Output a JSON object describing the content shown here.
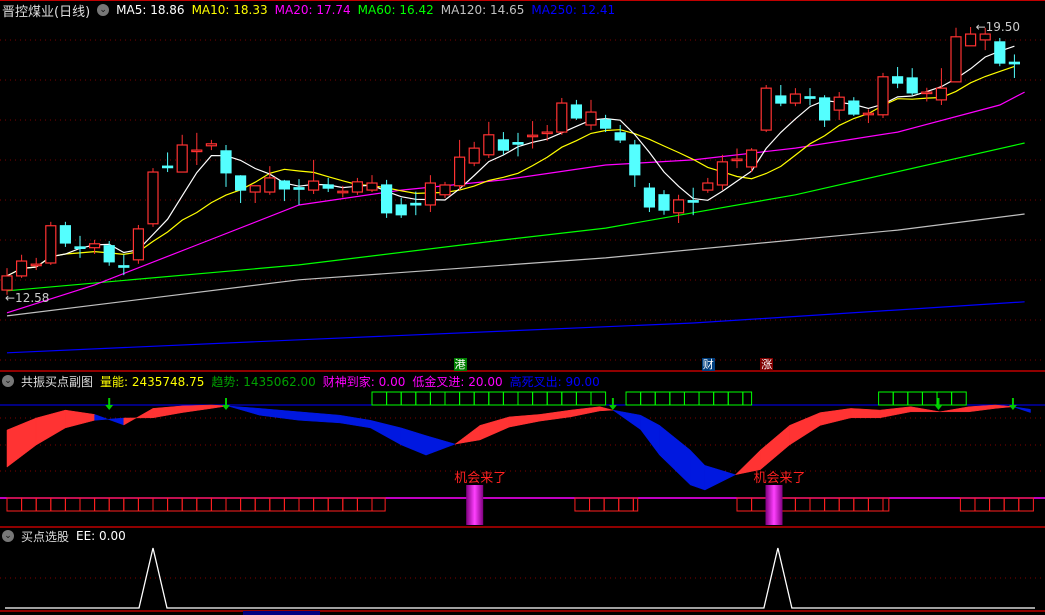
{
  "main": {
    "title": "晋控煤业(日线)",
    "ma": [
      {
        "label": "MA5: 18.86",
        "color": "#ffffff"
      },
      {
        "label": "MA10: 18.33",
        "color": "#ffff00"
      },
      {
        "label": "MA20: 17.74",
        "color": "#ff00ff"
      },
      {
        "label": "MA60: 16.42",
        "color": "#00ff00"
      },
      {
        "label": "MA120: 14.65",
        "color": "#c0c0c0"
      },
      {
        "label": "MA250: 12.41",
        "color": "#0000ff"
      }
    ],
    "high_label": "19.50",
    "low_label": "12.58",
    "markers": [
      {
        "text": "港",
        "bar": 31,
        "color": "#008000"
      },
      {
        "text": "财",
        "bar": 48,
        "color": "#003f7f"
      },
      {
        "text": "涨",
        "bar": 52,
        "color": "#800000"
      }
    ]
  },
  "sub1": {
    "title": "共振买点副图",
    "items": [
      {
        "label": "量能: 2435748.75",
        "color": "#ffff00"
      },
      {
        "label": "趋势: 1435062.00",
        "color": "#00a000"
      },
      {
        "label": "财神到家: 0.00",
        "color": "#ff00ff"
      },
      {
        "label": "低金叉进: 20.00",
        "color": "#ff00ff"
      },
      {
        "label": "高死叉出: 90.00",
        "color": "#0000ff"
      }
    ],
    "signal_text": "机会来了",
    "signal_bars": [
      32,
      52.5
    ],
    "arrows": [
      7,
      15,
      41.5,
      63.8,
      68.9
    ],
    "green_box_ranges": [
      [
        25,
        41.3
      ],
      [
        42.4,
        51
      ],
      [
        59.7,
        66
      ]
    ],
    "red_box_ranges": [
      [
        0,
        25.9
      ],
      [
        38.9,
        43.2
      ],
      [
        50,
        60.4
      ],
      [
        65.3,
        70.5
      ]
    ]
  },
  "sub2": {
    "title": "买点选股",
    "ee_label": "EE: 0.00",
    "peaks": [
      10,
      52.8
    ]
  },
  "chart_data": {
    "type": "candlestick",
    "ohlc": [
      [
        12.79,
        13.15,
        13.35,
        12.67
      ],
      [
        13.15,
        13.53,
        13.69,
        13.1
      ],
      [
        13.43,
        13.45,
        13.61,
        13.3
      ],
      [
        13.48,
        14.43,
        14.53,
        13.43
      ],
      [
        14.43,
        13.99,
        14.53,
        13.89
      ],
      [
        13.89,
        13.87,
        14.17,
        13.61
      ],
      [
        13.87,
        13.97,
        14.07,
        13.71
      ],
      [
        13.92,
        13.51,
        14.04,
        13.41
      ],
      [
        13.41,
        13.4,
        13.7,
        13.17
      ],
      [
        13.56,
        14.35,
        14.45,
        13.46
      ],
      [
        14.48,
        15.8,
        15.9,
        14.4
      ],
      [
        15.95,
        15.93,
        16.3,
        15.8
      ],
      [
        15.8,
        16.49,
        16.75,
        15.8
      ],
      [
        16.34,
        16.36,
        16.8,
        15.98
      ],
      [
        16.47,
        16.52,
        16.62,
        16.36
      ],
      [
        16.34,
        15.78,
        16.49,
        15.42
      ],
      [
        15.7,
        15.34,
        15.72,
        15.01
      ],
      [
        15.29,
        15.45,
        15.45,
        15.01
      ],
      [
        15.29,
        15.65,
        15.95,
        15.22
      ],
      [
        15.57,
        15.37,
        15.6,
        15.06
      ],
      [
        15.4,
        15.38,
        15.62,
        14.96
      ],
      [
        15.34,
        15.57,
        16.11,
        15.24
      ],
      [
        15.47,
        15.39,
        15.65,
        15.29
      ],
      [
        15.29,
        15.31,
        15.45,
        15.15
      ],
      [
        15.29,
        15.55,
        15.65,
        15.22
      ],
      [
        15.34,
        15.52,
        15.72,
        15.29
      ],
      [
        15.47,
        14.76,
        15.6,
        14.63
      ],
      [
        14.96,
        14.71,
        15.14,
        14.63
      ],
      [
        15.0,
        14.98,
        15.3,
        14.7
      ],
      [
        14.96,
        15.52,
        15.72,
        14.78
      ],
      [
        15.22,
        15.47,
        15.55,
        15.14
      ],
      [
        15.45,
        16.18,
        16.62,
        15.34
      ],
      [
        16.03,
        16.41,
        16.57,
        15.95
      ],
      [
        16.24,
        16.75,
        17.08,
        16.16
      ],
      [
        16.62,
        16.36,
        16.82,
        16.24
      ],
      [
        16.55,
        16.53,
        16.8,
        16.2
      ],
      [
        16.72,
        16.74,
        17.1,
        16.4
      ],
      [
        16.8,
        16.82,
        17.0,
        16.6
      ],
      [
        16.82,
        17.56,
        17.69,
        16.75
      ],
      [
        17.51,
        17.18,
        17.64,
        17.13
      ],
      [
        17.0,
        17.33,
        17.64,
        16.87
      ],
      [
        17.13,
        16.92,
        17.26,
        16.82
      ],
      [
        16.8,
        16.62,
        17.0,
        16.54
      ],
      [
        16.49,
        15.73,
        16.62,
        15.42
      ],
      [
        15.39,
        14.91,
        15.52,
        14.78
      ],
      [
        15.22,
        14.83,
        15.34,
        14.71
      ],
      [
        14.76,
        15.09,
        15.22,
        14.5
      ],
      [
        15.07,
        15.05,
        15.4,
        14.7
      ],
      [
        15.34,
        15.52,
        15.65,
        15.27
      ],
      [
        15.47,
        16.06,
        16.24,
        15.34
      ],
      [
        16.11,
        16.13,
        16.4,
        15.9
      ],
      [
        15.93,
        16.36,
        16.41,
        15.8
      ],
      [
        16.87,
        17.94,
        18.02,
        16.82
      ],
      [
        17.74,
        17.56,
        18.02,
        17.48
      ],
      [
        17.56,
        17.79,
        17.94,
        17.48
      ],
      [
        17.72,
        17.7,
        17.94,
        17.5
      ],
      [
        17.69,
        17.13,
        17.76,
        16.95
      ],
      [
        17.38,
        17.71,
        17.84,
        17.13
      ],
      [
        17.61,
        17.28,
        17.71,
        17.23
      ],
      [
        17.28,
        17.3,
        17.4,
        17.05
      ],
      [
        17.26,
        18.23,
        18.33,
        17.18
      ],
      [
        18.23,
        18.07,
        18.48,
        17.94
      ],
      [
        18.2,
        17.82,
        18.45,
        17.76
      ],
      [
        17.82,
        17.84,
        17.95,
        17.6
      ],
      [
        17.64,
        17.94,
        18.45,
        17.51
      ],
      [
        18.1,
        19.25,
        19.48,
        18.1
      ],
      [
        19.02,
        19.32,
        19.5,
        19.02
      ],
      [
        19.17,
        19.32,
        19.48,
        18.91
      ],
      [
        19.12,
        18.58,
        19.22,
        18.5
      ],
      [
        18.6,
        18.58,
        18.8,
        18.2
      ]
    ],
    "ma20": [
      [
        0,
        12.21
      ],
      [
        6,
        12.92
      ],
      [
        13,
        13.94
      ],
      [
        20,
        14.96
      ],
      [
        27,
        15.34
      ],
      [
        34,
        15.6
      ],
      [
        41,
        15.98
      ],
      [
        47,
        16.11
      ],
      [
        54,
        16.41
      ],
      [
        61,
        16.82
      ],
      [
        68,
        17.51
      ],
      [
        69.7,
        17.84
      ]
    ],
    "ma60": [
      [
        0,
        12.77
      ],
      [
        20,
        13.43
      ],
      [
        34,
        14.07
      ],
      [
        41,
        14.37
      ],
      [
        54,
        15.22
      ],
      [
        69.7,
        16.54
      ]
    ],
    "ma120": [
      [
        0,
        12.13
      ],
      [
        20,
        13.05
      ],
      [
        41,
        13.61
      ],
      [
        61,
        14.32
      ],
      [
        69.7,
        14.73
      ]
    ],
    "ma250": [
      [
        0,
        11.19
      ],
      [
        20,
        11.52
      ],
      [
        47,
        11.95
      ],
      [
        69.7,
        12.49
      ]
    ],
    "price_range": [
      10.5,
      20.2
    ],
    "ribbon": {
      "x": [
        0,
        2,
        4,
        6,
        8,
        10,
        12,
        14,
        15.1,
        17.3,
        20,
        22.8,
        24.9,
        27,
        28.7,
        30.7,
        32.4,
        34.4,
        36.5,
        38.6,
        40.6,
        41.5,
        43.4,
        44.7,
        46.8,
        47.8,
        49.9,
        51.6,
        53.6,
        55.7,
        57.8,
        59.8,
        61.9,
        63.9,
        65.9,
        67.7,
        68.9,
        70.1
      ],
      "fast": [
        70.6,
        84.7,
        94,
        89,
        76.5,
        96,
        99,
        100,
        99,
        88,
        82,
        79,
        73,
        53,
        41,
        54,
        76,
        86,
        89,
        94,
        98,
        94,
        71,
        41,
        6,
        0,
        18,
        47,
        76,
        91,
        96,
        94,
        98,
        92,
        98,
        100,
        98,
        91
      ],
      "slow": [
        27,
        52.9,
        73,
        82,
        84.7,
        85,
        91,
        96,
        99,
        96,
        92,
        88,
        82,
        73,
        64,
        54,
        59,
        74,
        81,
        86,
        93,
        94,
        88,
        76,
        47,
        29,
        18,
        24,
        53,
        76,
        85,
        85,
        92,
        92,
        92,
        96,
        98,
        95
      ]
    }
  }
}
